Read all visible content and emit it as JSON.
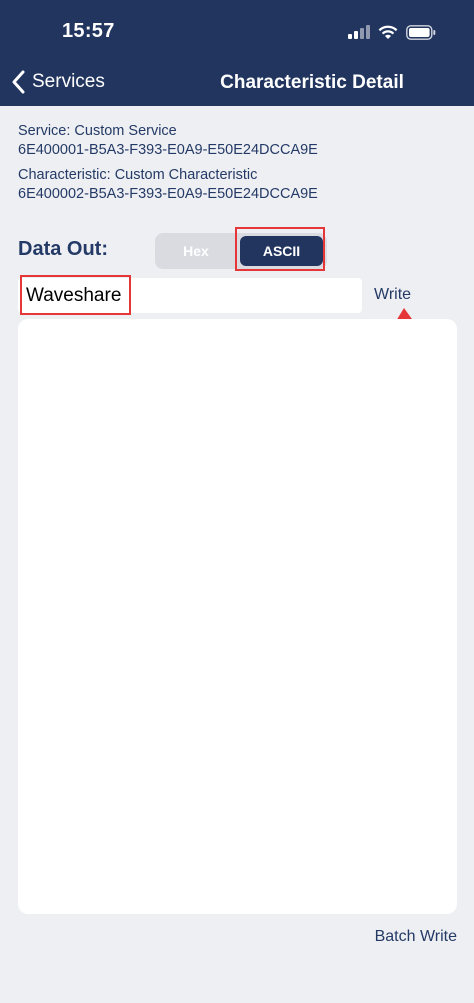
{
  "status_bar": {
    "time": "15:57",
    "icons": [
      "cellular-signal-icon",
      "wifi-icon",
      "battery-icon"
    ]
  },
  "nav": {
    "back_label": "Services",
    "title": "Characteristic Detail"
  },
  "service": {
    "line1": "Service: Custom Service",
    "uuid": "6E400001-B5A3-F393-E0A9-E50E24DCCA9E"
  },
  "characteristic": {
    "line1": "Characteristic: Custom Characteristic",
    "uuid": "6E400002-B5A3-F393-E0A9-E50E24DCCA9E"
  },
  "data_out": {
    "label": "Data Out:",
    "options": [
      "Hex",
      "ASCII"
    ],
    "selected": "ASCII"
  },
  "input": {
    "value": "Waveshare"
  },
  "actions": {
    "write": "Write",
    "batch_write": "Batch Write"
  },
  "colors": {
    "nav_background": "#22355f",
    "accent_text": "#243a66",
    "highlight": "#e53638",
    "page_background": "#eeeff3"
  }
}
